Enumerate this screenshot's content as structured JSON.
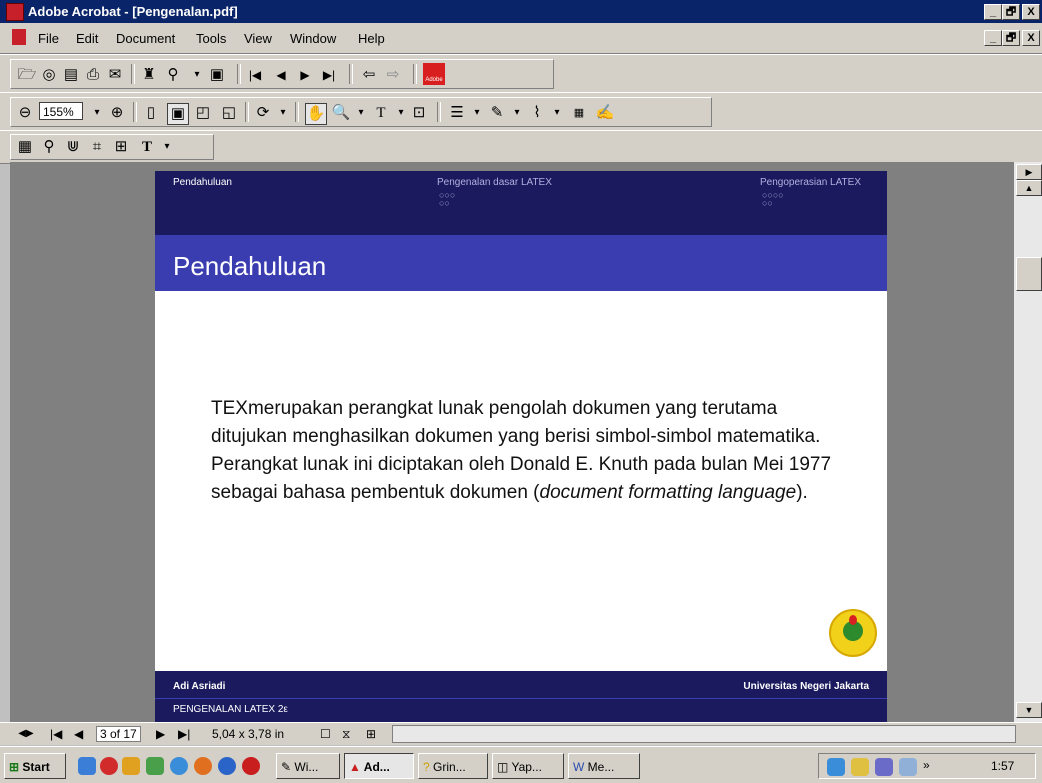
{
  "window": {
    "title": "Adobe Acrobat - [Pengenalan.pdf]",
    "controls": [
      "_",
      "🗗",
      "X"
    ]
  },
  "menubar": {
    "items": [
      {
        "label": "File"
      },
      {
        "label": "Edit"
      },
      {
        "label": "Document"
      },
      {
        "label": "Tools"
      },
      {
        "label": "View"
      },
      {
        "label": "Window"
      },
      {
        "label": "Help"
      }
    ]
  },
  "toolbar": {
    "zoom_value": "155%",
    "adobe_label": "Adobe"
  },
  "slide": {
    "nav_left": "Pendahuluan",
    "nav_center": "Pengenalan dasar LATEX",
    "nav_center_dots": "○○○\n○○",
    "nav_right": "Pengoperasian LATEX",
    "nav_right_dots": "○○○○\n○○",
    "heading": "Pendahuluan",
    "body_prefix": "TEX",
    "body_main": "merupakan perangkat lunak pengolah dokumen yang terutama ditujukan menghasilkan dokumen yang berisi simbol-simbol matematika. Perangkat lunak ini diciptakan oleh Donald E. Knuth pada bulan Mei 1977 sebagai bahasa pembentuk dokumen (",
    "body_italic": "document formatting language",
    "body_suffix": ").",
    "footer_author": "Adi Asriadi",
    "footer_institution": "Universitas Negeri Jakarta",
    "footer_title": "PENGENALAN LATEX 2ε"
  },
  "statusbar": {
    "page": "3 of 17",
    "dimensions": "5,04 x 3,78 in"
  },
  "taskbar": {
    "start": "Start",
    "buttons": [
      {
        "label": "Wi...",
        "icon": "pen-icon"
      },
      {
        "label": "Ad...",
        "icon": "acrobat-icon",
        "active": true
      },
      {
        "label": "Grin...",
        "icon": "help-icon"
      },
      {
        "label": "Yap...",
        "icon": "dvi-icon"
      },
      {
        "label": "Me...",
        "icon": "word-icon"
      }
    ],
    "clock": "1:57"
  },
  "colors": {
    "titlebar": "#0a246a",
    "slide_dark": "#1b1a5e",
    "slide_band": "#3a3db0"
  }
}
